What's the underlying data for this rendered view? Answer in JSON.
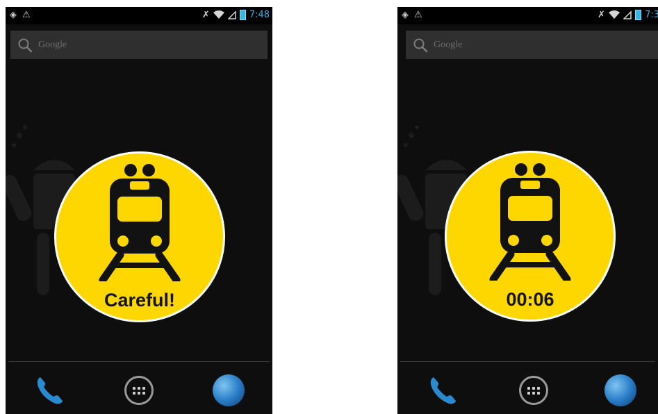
{
  "screens": [
    {
      "status": {
        "time": "7:48"
      },
      "search": {
        "placeholder": "Google"
      },
      "badge": {
        "label": "Careful!",
        "color": "#ffd700"
      }
    },
    {
      "status": {
        "time": "7:3"
      },
      "search": {
        "placeholder": "Google"
      },
      "badge": {
        "label": "00:06",
        "color": "#ffd700"
      }
    }
  ],
  "colors": {
    "background": "#0e0e0e",
    "accent": "#33b5e5",
    "badge": "#ffd700",
    "badge_text": "#141414"
  },
  "icons": {
    "status_left": [
      "location-icon",
      "usb-debug-icon"
    ],
    "status_right": [
      "signal-off-icon",
      "wifi-icon",
      "cell-signal-icon",
      "battery-icon"
    ],
    "dock": [
      "phone-icon",
      "app-drawer-icon",
      "browser-globe-icon"
    ],
    "badge": "train-icon"
  }
}
